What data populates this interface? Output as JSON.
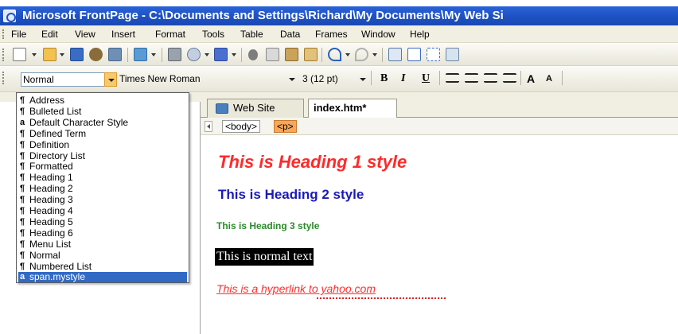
{
  "window": {
    "title": "Microsoft FrontPage - C:\\Documents and Settings\\Richard\\My Documents\\My Web Si"
  },
  "menu": [
    "File",
    "Edit",
    "View",
    "Insert",
    "Format",
    "Tools",
    "Table",
    "Data",
    "Frames",
    "Window",
    "Help"
  ],
  "formatting": {
    "style_value": "Normal",
    "font_value": "Times New Roman",
    "size_value": "3 (12 pt)",
    "bold": "B",
    "italic": "I",
    "underline": "U"
  },
  "style_dropdown": {
    "items": [
      {
        "mark": "¶",
        "label": "Address"
      },
      {
        "mark": "¶",
        "label": "Bulleted List"
      },
      {
        "mark": "a",
        "label": "Default Character Style"
      },
      {
        "mark": "¶",
        "label": "Defined Term"
      },
      {
        "mark": "¶",
        "label": "Definition"
      },
      {
        "mark": "¶",
        "label": "Directory List"
      },
      {
        "mark": "¶",
        "label": "Formatted"
      },
      {
        "mark": "¶",
        "label": "Heading 1"
      },
      {
        "mark": "¶",
        "label": "Heading 2"
      },
      {
        "mark": "¶",
        "label": "Heading 3"
      },
      {
        "mark": "¶",
        "label": "Heading 4"
      },
      {
        "mark": "¶",
        "label": "Heading 5"
      },
      {
        "mark": "¶",
        "label": "Heading 6"
      },
      {
        "mark": "¶",
        "label": "Menu List"
      },
      {
        "mark": "¶",
        "label": "Normal"
      },
      {
        "mark": "¶",
        "label": "Numbered List"
      },
      {
        "mark": "a",
        "label": "span.mystyle"
      }
    ],
    "selected_index": 16
  },
  "tabs": {
    "web_site": "Web Site",
    "index": "index.htm*"
  },
  "tag_selector": {
    "body": "<body>",
    "p": "<p>"
  },
  "document": {
    "heading1": "This is Heading 1 style",
    "heading2": "This is Heading 2 style",
    "heading3": "This is Heading 3 style",
    "normal": "This is normal text",
    "hyperlink": "This is a hyperlink to yahoo.com"
  },
  "colors": {
    "heading1": "#ff2a2a",
    "heading2": "#1a1ab8",
    "heading3": "#2a8a2a",
    "selection": "#316ac5"
  }
}
